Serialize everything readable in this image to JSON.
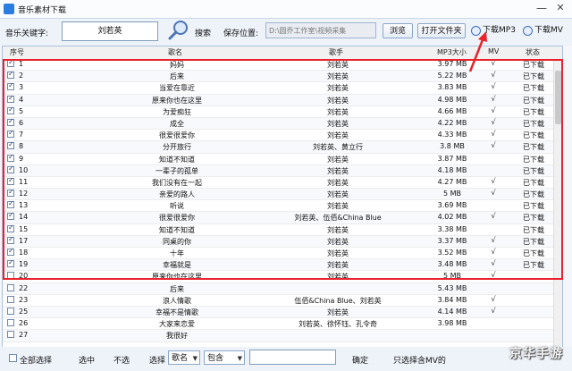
{
  "window": {
    "title": "音乐素材下载",
    "minimize": "—",
    "close": "✕"
  },
  "toolbar": {
    "keyword_label": "音乐关键字:",
    "keyword_value": "刘若英",
    "search_label": "搜索",
    "save_label": "保存位置:",
    "save_path": "D:\\圆乔工作室\\视频采集",
    "browse_button": "浏览",
    "open_folder_button": "打开文件夹",
    "download_mp3": "下载MP3",
    "download_mv": "下载MV"
  },
  "table": {
    "headers": {
      "index": "序号",
      "name": "歌名",
      "singer": "歌手",
      "size": "MP3大小",
      "mv": "MV",
      "status": "状态"
    },
    "rows": [
      {
        "checked": true,
        "num": "1",
        "name": "妈妈",
        "singer": "刘若英",
        "size": "3.97 MB",
        "mv": "√",
        "status": "已下载"
      },
      {
        "checked": true,
        "num": "2",
        "name": "后来",
        "singer": "刘若英",
        "size": "5.22 MB",
        "mv": "√",
        "status": "已下载"
      },
      {
        "checked": true,
        "num": "3",
        "name": "当爱在靠近",
        "singer": "刘若英",
        "size": "3.83 MB",
        "mv": "√",
        "status": "已下载"
      },
      {
        "checked": true,
        "num": "4",
        "name": "原来你也在这里",
        "singer": "刘若英",
        "size": "4.98 MB",
        "mv": "√",
        "status": "已下载"
      },
      {
        "checked": true,
        "num": "5",
        "name": "为爱痴狂",
        "singer": "刘若英",
        "size": "4.66 MB",
        "mv": "√",
        "status": "已下载"
      },
      {
        "checked": true,
        "num": "6",
        "name": "成全",
        "singer": "刘若英",
        "size": "4.22 MB",
        "mv": "√",
        "status": "已下载"
      },
      {
        "checked": true,
        "num": "7",
        "name": "很爱很爱你",
        "singer": "刘若英",
        "size": "4.33 MB",
        "mv": "√",
        "status": "已下载"
      },
      {
        "checked": true,
        "num": "8",
        "name": "分开旅行",
        "singer": "刘若英、黄立行",
        "size": "3.8 MB",
        "mv": "√",
        "status": "已下载"
      },
      {
        "checked": true,
        "num": "9",
        "name": "知道不知道",
        "singer": "刘若英",
        "size": "3.87 MB",
        "mv": "",
        "status": "已下载"
      },
      {
        "checked": true,
        "num": "10",
        "name": "一辈子的孤单",
        "singer": "刘若英",
        "size": "4.18 MB",
        "mv": "",
        "status": "已下载"
      },
      {
        "checked": true,
        "num": "11",
        "name": "我们没有在一起",
        "singer": "刘若英",
        "size": "4.27 MB",
        "mv": "√",
        "status": "已下载"
      },
      {
        "checked": true,
        "num": "12",
        "name": "亲爱的路人",
        "singer": "刘若英",
        "size": "5 MB",
        "mv": "√",
        "status": "已下载"
      },
      {
        "checked": true,
        "num": "13",
        "name": "听说",
        "singer": "刘若英",
        "size": "3.69 MB",
        "mv": "",
        "status": "已下载"
      },
      {
        "checked": true,
        "num": "14",
        "name": "很爱很爱你",
        "singer": "刘若英、伍佰&China Blue",
        "size": "4.02 MB",
        "mv": "√",
        "status": "已下载"
      },
      {
        "checked": true,
        "num": "15",
        "name": "知道不知道",
        "singer": "刘若英",
        "size": "3.38 MB",
        "mv": "",
        "status": "已下载"
      },
      {
        "checked": true,
        "num": "17",
        "name": "同桌的你",
        "singer": "刘若英",
        "size": "3.37 MB",
        "mv": "√",
        "status": "已下载"
      },
      {
        "checked": true,
        "num": "18",
        "name": "十年",
        "singer": "刘若英",
        "size": "3.52 MB",
        "mv": "√",
        "status": "已下载"
      },
      {
        "checked": true,
        "num": "19",
        "name": "幸福就是",
        "singer": "刘若英",
        "size": "3.48 MB",
        "mv": "√",
        "status": "已下载"
      },
      {
        "checked": false,
        "num": "20",
        "name": "原来你也在这里",
        "singer": "刘若英",
        "size": "5 MB",
        "mv": "√",
        "status": ""
      },
      {
        "checked": false,
        "num": "22",
        "name": "后来",
        "singer": "",
        "size": "5.43 MB",
        "mv": "",
        "status": ""
      },
      {
        "checked": false,
        "num": "23",
        "name": "浪人情歌",
        "singer": "伍佰&China Blue、刘若英",
        "size": "3.84 MB",
        "mv": "√",
        "status": ""
      },
      {
        "checked": false,
        "num": "25",
        "name": "幸福不是情歌",
        "singer": "刘若英",
        "size": "4.14 MB",
        "mv": "√",
        "status": ""
      },
      {
        "checked": false,
        "num": "26",
        "name": "大家来恋爱",
        "singer": "刘若英、徐怀钰、孔令奇",
        "size": "3.98 MB",
        "mv": "",
        "status": ""
      },
      {
        "checked": false,
        "num": "27",
        "name": "我很好",
        "singer": "",
        "size": "",
        "mv": "",
        "status": ""
      }
    ]
  },
  "bottom": {
    "select_all": "全部选择",
    "select_checked": "选中",
    "select_none": "不选",
    "select_label": "选择",
    "field_option": "歌名",
    "mode_option": "包含",
    "confirm": "确定",
    "only_mv": "只选择含MV的"
  },
  "watermark": "京华手游"
}
